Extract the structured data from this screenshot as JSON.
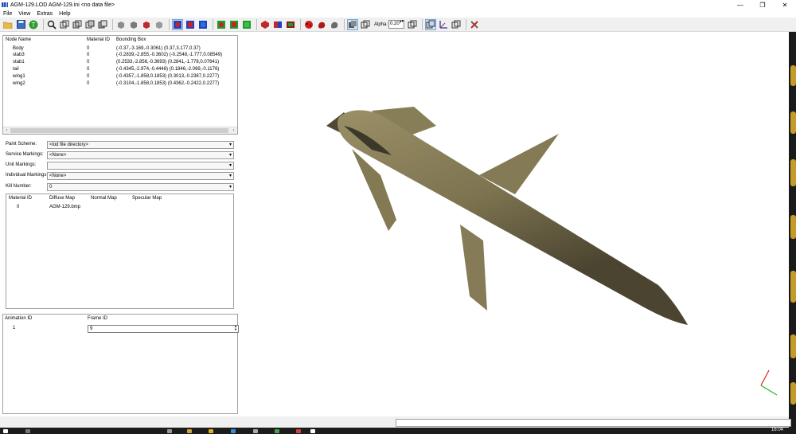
{
  "window": {
    "title": "AGM-129.LOD  AGM-129.ini  <no data file>",
    "controls": {
      "minimize": "—",
      "maximize": "❐",
      "close": "✕"
    }
  },
  "menu": {
    "items": [
      "File",
      "View",
      "Extras",
      "Help"
    ]
  },
  "toolbar": {
    "alpha_label": "Alpha:",
    "alpha_value": "0.20",
    "buttons": [
      "open-folder-icon",
      "save-icon",
      "texture-t-icon",
      "zoom-fit-icon",
      "cube-wire-icon",
      "cube-wire-front-icon",
      "cube-wire-side-icon",
      "cube-wire-top-icon",
      "solid-gray-icon",
      "solid-gray-2-icon",
      "solid-red-icon",
      "solid-gray-3-icon",
      "blue-box-icon",
      "blue-box-2-icon",
      "blue-box-3-icon",
      "green-box-icon",
      "green-box-2-icon",
      "green-box-3-icon",
      "red-shape-icon",
      "red-shape-2-icon",
      "red-shape-3-icon",
      "ladybug-icon",
      "red-blob-icon",
      "gray-blob-icon",
      "box-icon",
      "box-2-icon",
      "box-3-icon",
      "axes-icon",
      "box-4-icon",
      "tools-icon"
    ]
  },
  "nodes": {
    "headers": [
      "Node Name",
      "Material ID",
      "Bounding Box"
    ],
    "rows": [
      {
        "name": "Body",
        "material": "0",
        "bbox": "(-0.37,-3.169,-0.3061) (0.37,3.177,0.37)"
      },
      {
        "name": "stab3",
        "material": "0",
        "bbox": "(-0.2839,-2.855,-0.3602) (-0.2548,-1.777,0.08549)"
      },
      {
        "name": "stab1",
        "material": "0",
        "bbox": "(0.2533,-2.856,-0.3693) (0.2841,-1.778,0.07641)"
      },
      {
        "name": "tail",
        "material": "0",
        "bbox": "(-0.4345,-2.974,-0.4448) (0.1846,-2.069,-0.1176)"
      },
      {
        "name": "wing1",
        "material": "0",
        "bbox": "(-0.4357,-1.858,0.1853) (0.3013,-0.2387,0.2277)"
      },
      {
        "name": "wing2",
        "material": "0",
        "bbox": "(-0.3104,-1.858,0.1853) (0.4362,-0.2422,0.2277)"
      }
    ]
  },
  "settings": [
    {
      "label": "Paint Scheme:",
      "value": "<lod file directory>"
    },
    {
      "label": "Service Markings:",
      "value": "<None>"
    },
    {
      "label": "Unit Markings:",
      "value": ""
    },
    {
      "label": "Individual Markings:",
      "value": "<None>"
    },
    {
      "label": "Kill Number:",
      "value": "0"
    }
  ],
  "maps": {
    "headers": [
      "Material ID",
      "Diffuse Map",
      "Normal Map",
      "Specular Map"
    ],
    "rows": [
      {
        "material": "0",
        "diffuse": "AGM-129.bmp",
        "normal": "",
        "specular": ""
      }
    ]
  },
  "animations": {
    "headers": [
      "Animation ID",
      "Frame ID"
    ],
    "rows": [
      {
        "id": "1",
        "frame": "9"
      }
    ]
  },
  "colors": {
    "model_fill": "#847a55",
    "model_dark": "#4a4430",
    "axis_x": "#e0201c",
    "axis_y": "#1fb81f"
  },
  "taskbar": {
    "clock": "16:04"
  }
}
